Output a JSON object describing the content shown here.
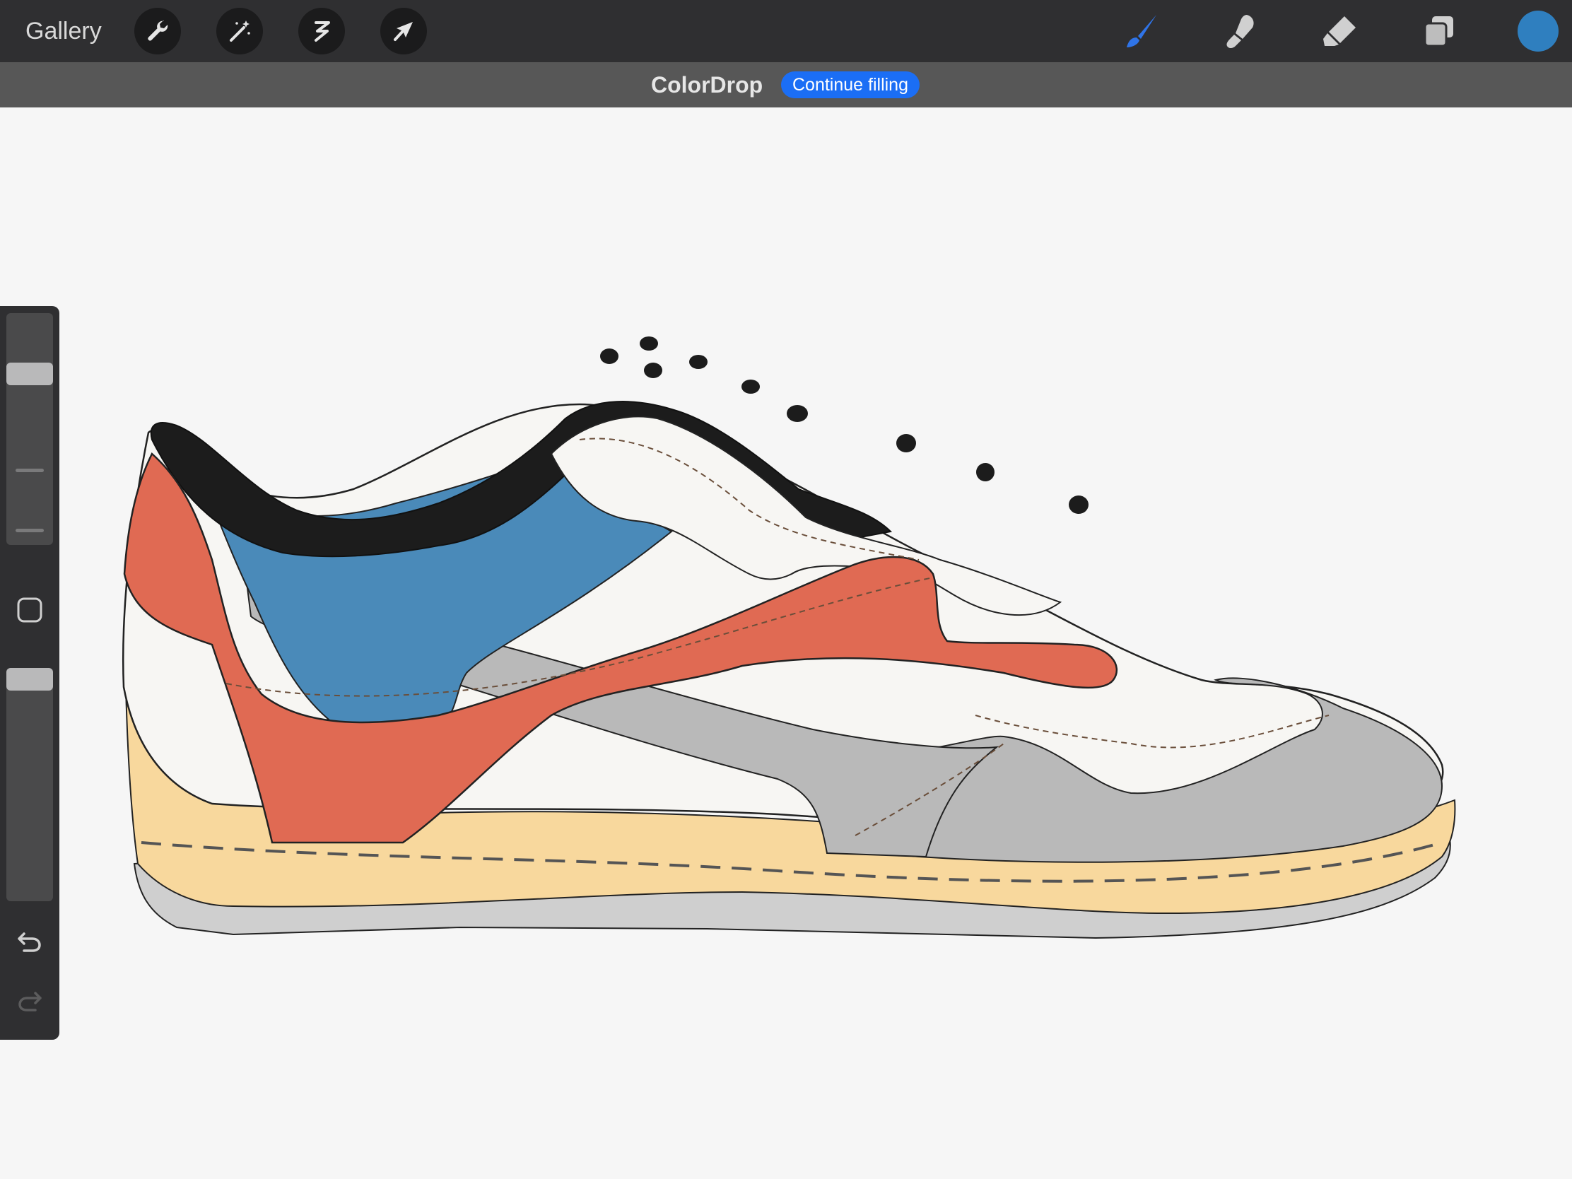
{
  "toolbar": {
    "gallery_label": "Gallery",
    "left_tools": [
      "wrench-icon",
      "magic-wand-icon",
      "selection-icon",
      "move-arrow-icon"
    ],
    "right_tools": [
      "brush-icon",
      "smudge-icon",
      "eraser-icon",
      "layers-icon"
    ],
    "active_tool": "brush",
    "current_color": "#2f7fbf",
    "active_accent": "#2f74e8"
  },
  "banner": {
    "title": "ColorDrop",
    "action_label": "Continue filling",
    "action_color": "#1b6ef5"
  },
  "sidebar": {
    "brush_size_level": 0.75,
    "opacity_level": 1.0,
    "icons": [
      "square-modifier-icon",
      "undo-icon",
      "redo-icon"
    ]
  },
  "artwork": {
    "subject": "sneaker-side-view",
    "colors": {
      "collar": "#1c1c1c",
      "heel_counter": "#e06a53",
      "side_panel": "#4a8ab9",
      "upper": "#f7f6f3",
      "overlay_gray": "#b9b9b9",
      "midsole": "#f8d89d",
      "outsole": "#cfcfcf",
      "swoosh": "#e06a53"
    }
  }
}
